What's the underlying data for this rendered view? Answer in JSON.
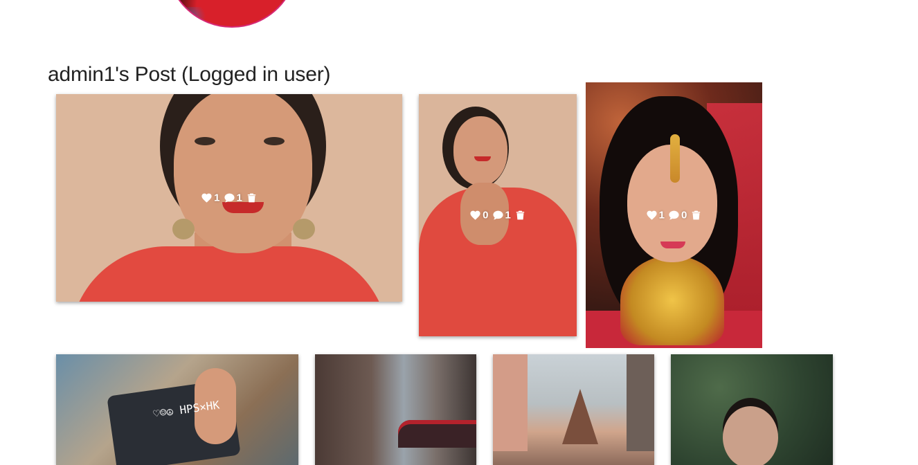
{
  "profile": {
    "avatar_colors": {
      "border": "#d62976",
      "shirt": "#d8202a"
    }
  },
  "section": {
    "title": "admin1's Post (Logged in user)"
  },
  "posts": [
    {
      "likes": "1",
      "comments": "1",
      "delete_icon": "trash-icon"
    },
    {
      "likes": "0",
      "comments": "1",
      "delete_icon": "trash-icon"
    },
    {
      "likes": "1",
      "comments": "0",
      "delete_icon": "trash-icon"
    }
  ],
  "more_posts": {
    "sign_text": "♡☺☮ HPS×HK"
  },
  "icons": {
    "like": "heart-icon",
    "comment": "comment-icon",
    "delete": "trash-icon"
  }
}
